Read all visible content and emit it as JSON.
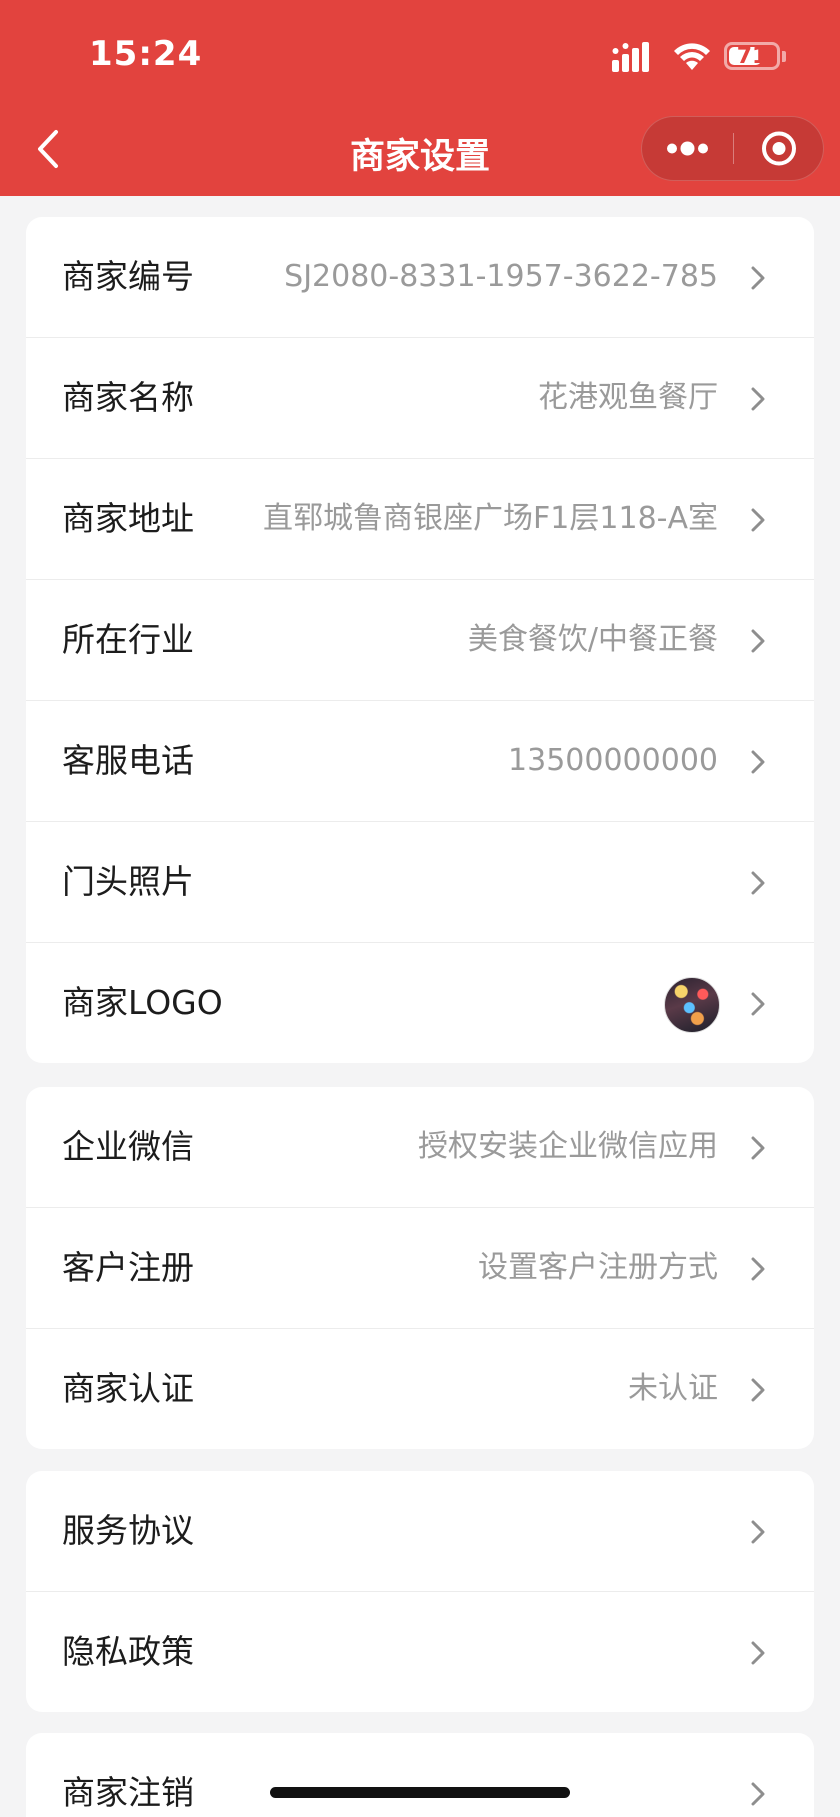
{
  "status_bar": {
    "time": "15:24",
    "battery": "71",
    "battery_level": 0.71,
    "icons": [
      "signal-icon",
      "wifi-icon",
      "battery-icon"
    ]
  },
  "nav": {
    "title": "商家设置",
    "back_icon": "chevron-left-icon",
    "more_icon": "more-dots-icon",
    "close_icon": "target-circle-icon"
  },
  "colors": {
    "brand": "#e2433e",
    "background": "#f4f4f5",
    "label": "#1c1c1c",
    "value": "#9a9a9a"
  },
  "sections": [
    {
      "rows": [
        {
          "label": "商家编号",
          "value": "SJ2080-8331-1957-3622-785"
        },
        {
          "label": "商家名称",
          "value": "花港观鱼餐厅"
        },
        {
          "label": "商家地址",
          "value": "直郓城鲁商银座广场F1层118-A室"
        },
        {
          "label": "所在行业",
          "value": "美食餐饮/中餐正餐"
        },
        {
          "label": "客服电话",
          "value": "13500000000"
        },
        {
          "label": "门头照片",
          "value": ""
        },
        {
          "label": "商家LOGO",
          "value": ""
        }
      ]
    },
    {
      "rows": [
        {
          "label": "企业微信",
          "value": "授权安装企业微信应用"
        },
        {
          "label": "客户注册",
          "value": "设置客户注册方式"
        },
        {
          "label": "商家认证",
          "value": "未认证"
        }
      ]
    },
    {
      "rows": [
        {
          "label": "服务协议",
          "value": ""
        },
        {
          "label": "隐私政策",
          "value": ""
        }
      ]
    },
    {
      "rows": [
        {
          "label": "商家注销",
          "value": ""
        }
      ]
    }
  ]
}
